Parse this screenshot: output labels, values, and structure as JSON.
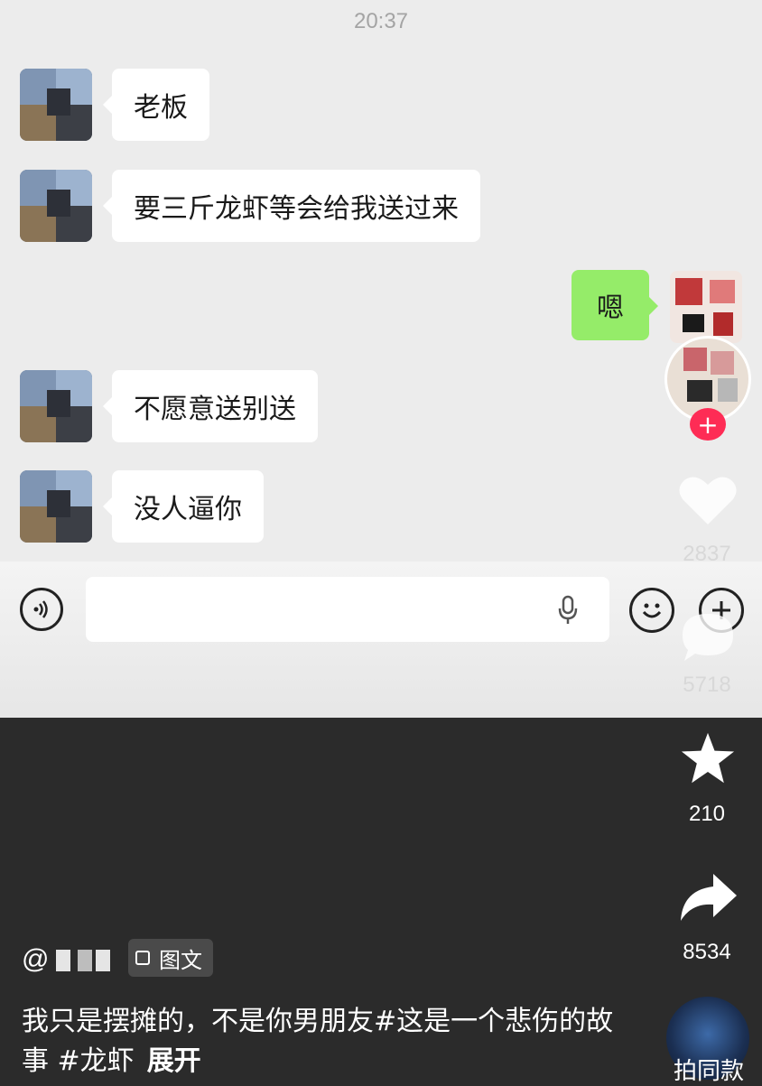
{
  "chat": {
    "time": "20:37",
    "messages": [
      {
        "side": "left",
        "text": "老板"
      },
      {
        "side": "left",
        "text": "要三斤龙虾等会给我送过来"
      },
      {
        "side": "right",
        "text": "嗯"
      },
      {
        "side": "left",
        "text": "不愿意送别送"
      },
      {
        "side": "left",
        "text": "没人逼你"
      }
    ]
  },
  "sidebar": {
    "likes": "2837",
    "comments": "5718",
    "favorites": "210",
    "shares": "8534",
    "same_style_label": "拍同款",
    "follow_symbol": "+"
  },
  "info": {
    "at_symbol": "@",
    "tag_label": "图文",
    "caption": "我只是摆摊的，不是你男朋友#这是一个悲伤的故事 #龙虾",
    "expand_label": "展开"
  },
  "colors": {
    "chat_bg": "#ececec",
    "bubble_white": "#ffffff",
    "bubble_green": "#95ec69",
    "bottom_bg": "#2b2b2b",
    "follow_red": "#fe2c55"
  }
}
